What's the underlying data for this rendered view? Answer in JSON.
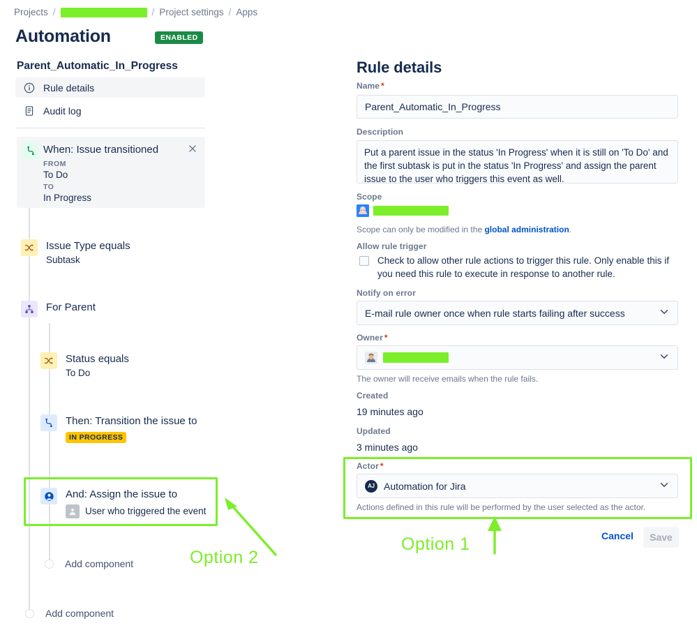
{
  "breadcrumb": {
    "projects": "Projects",
    "project_redacted": "",
    "project_settings": "Project settings",
    "apps": "Apps",
    "separator": "/"
  },
  "header": {
    "title": "Automation",
    "status_badge": "ENABLED",
    "badge_color": "#1C8A47"
  },
  "sidebar": {
    "rule_name": "Parent_Automatic_In_Progress",
    "items": [
      {
        "label": "Rule details",
        "icon": "info-circle-icon",
        "active": true
      },
      {
        "label": "Audit log",
        "icon": "document-list-icon",
        "active": false
      }
    ]
  },
  "flow": {
    "trigger": {
      "title": "When: Issue transitioned",
      "from_label": "FROM",
      "from_value": "To Do",
      "to_label": "TO",
      "to_value": "In Progress",
      "icon": "transition-icon",
      "close_icon": "close-icon"
    },
    "nodes": [
      {
        "title": "Issue Type equals",
        "sub": "Subtask",
        "icon": "condition-shuffle-icon"
      },
      {
        "title": "For Parent",
        "sub": "",
        "icon": "branch-hierarchy-icon"
      },
      {
        "title": "Status equals",
        "sub": "To Do",
        "icon": "condition-shuffle-icon"
      },
      {
        "title": "Then: Transition the issue to",
        "lozenge": "IN PROGRESS",
        "icon": "transition-icon"
      },
      {
        "title": "And: Assign the issue to",
        "sub": "User who triggered the event",
        "icon": "assign-user-icon"
      }
    ],
    "add_component_branch": "Add component",
    "add_component_main": "Add component"
  },
  "annotations": {
    "option1": "Option 1",
    "option2": "Option 2",
    "highlight_color": "#7CEE2A"
  },
  "details": {
    "title": "Rule details",
    "name": {
      "label": "Name",
      "required": true,
      "value": "Parent_Automatic_In_Progress"
    },
    "description": {
      "label": "Description",
      "value": "Put a parent issue in the status 'In Progress' when it is still on 'To Do' and the first subtask is put in the status 'In Progress' and assign the parent issue to the user who triggers this event as well."
    },
    "scope": {
      "label": "Scope",
      "value_redacted": "",
      "help_prefix": "Scope can only be modified in the ",
      "help_link": "global administration",
      "help_suffix": "."
    },
    "allow_rule_trigger": {
      "label": "Allow rule trigger",
      "checkbox_text": "Check to allow other rule actions to trigger this rule. Only enable this if you need this rule to execute in response to another rule.",
      "checked": false
    },
    "notify_on_error": {
      "label": "Notify on error",
      "value": "E-mail rule owner once when rule starts failing after success"
    },
    "owner": {
      "label": "Owner",
      "required": true,
      "value_redacted": "",
      "help": "The owner will receive emails when the rule fails."
    },
    "created": {
      "label": "Created",
      "value": "19 minutes ago"
    },
    "updated": {
      "label": "Updated",
      "value": "3 minutes ago"
    },
    "actor": {
      "label": "Actor",
      "required": true,
      "value": "Automation for Jira",
      "avatar_initials": "AJ",
      "help": "Actions defined in this rule will be performed by the user selected as the actor."
    },
    "buttons": {
      "cancel": "Cancel",
      "save": "Save"
    }
  }
}
